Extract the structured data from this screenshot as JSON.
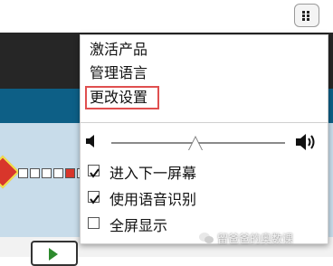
{
  "menu": {
    "items": [
      "激活产品",
      "管理语言",
      "更改设置"
    ],
    "highlighted_index": 2,
    "volume": 0.5,
    "checks": [
      {
        "label": "进入下一屏幕",
        "checked": true
      },
      {
        "label": "使用语音识别",
        "checked": true
      },
      {
        "label": "全屏显示",
        "checked": false
      }
    ]
  },
  "icons": {
    "menu": "menu-grid-icon",
    "volume_low": "speaker-low-icon",
    "volume_high": "speaker-high-icon",
    "wechat": "wechat-icon"
  },
  "watermark": "留爸爸的奥数课",
  "colors": {
    "highlight": "#e04f4f",
    "app_teal": "#0d5f86",
    "app_dark": "#262626"
  }
}
